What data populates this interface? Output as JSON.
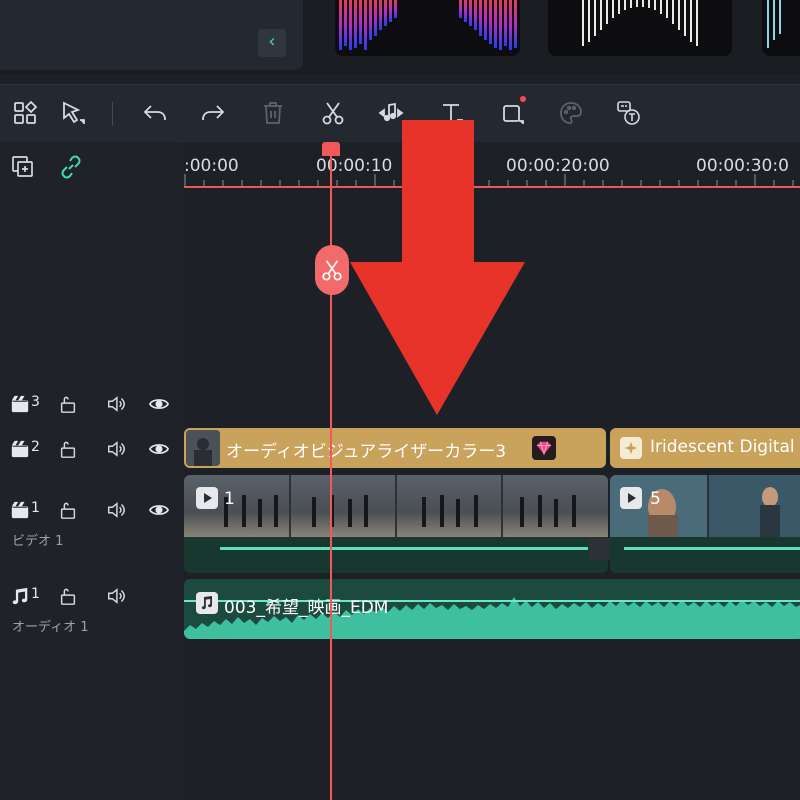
{
  "ruler": {
    "timecodes": [
      ":00:00",
      "00:00:10",
      "00:00:20:00",
      "00:00:30:0"
    ]
  },
  "tracks": [
    {
      "id": "3",
      "type": "video",
      "num": "3",
      "label": ""
    },
    {
      "id": "2",
      "type": "video",
      "num": "2",
      "label": ""
    },
    {
      "id": "1",
      "type": "video",
      "num": "1",
      "label": "ビデオ 1"
    },
    {
      "id": "a1",
      "type": "audio",
      "num": "1",
      "label": "オーディオ 1"
    }
  ],
  "clips": {
    "track2_clip1": "オーディオビジュアライザーカラー3",
    "track2_clip2": "Iridescent Digital",
    "video_clip1_index": "1",
    "video_clip2_index": "5",
    "audio_clip": "003_希望_映画_EDM"
  },
  "colors": {
    "accent": "#3fd9b4",
    "playhead": "#f2585a",
    "gold_clip": "#c9a35c",
    "audio_wave": "#3ebf9f",
    "arrow": "#e8332a"
  }
}
